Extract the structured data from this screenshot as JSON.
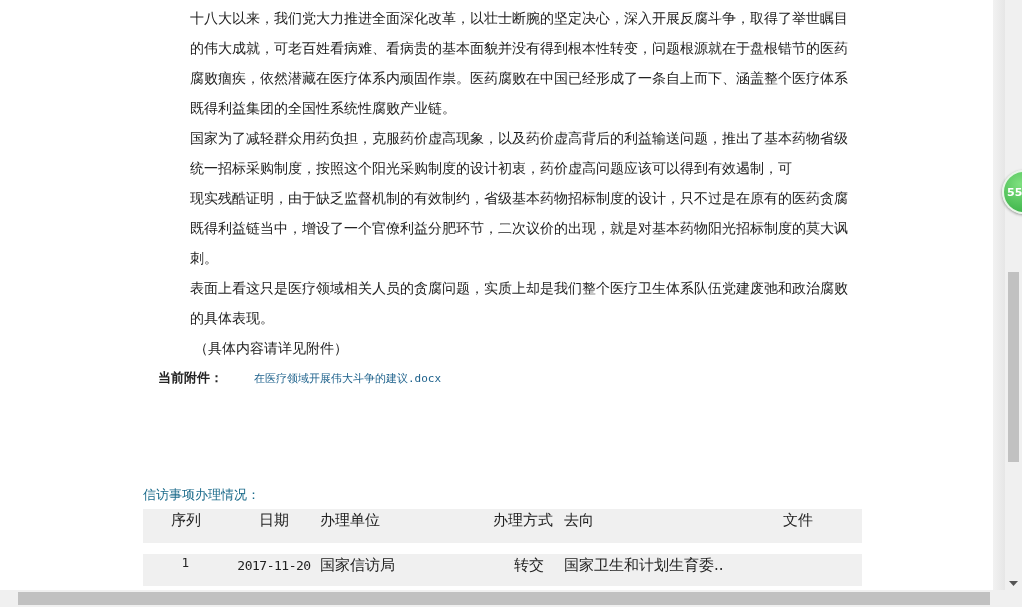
{
  "article": {
    "paragraphs": [
      "十八大以来，我们党大力推进全面深化改革，以壮士断腕的坚定决心，深入开展反腐斗争，取得了举世瞩目的伟大成就，可老百姓看病难、看病贵的基本面貌并没有得到根本性转变，问题根源就在于盘根错节的医药腐败痼疾，依然潜藏在医疗体系内顽固作祟。医药腐败在中国已经形成了一条自上而下、涵盖整个医疗体系既得利益集团的全国性系统性腐败产业链。",
      "国家为了减轻群众用药负担，克服药价虚高现象，以及药价虚高背后的利益输送问题，推出了基本药物省级统一招标采购制度，按照这个阳光采购制度的设计初衷，药价虚高问题应该可以得到有效遏制，可",
      "现实残酷证明，由于缺乏监督机制的有效制约，省级基本药物招标制度的设计，只不过是在原有的医药贪腐既得利益链当中，增设了一个官僚利益分肥环节，二次议价的出现，就是对基本药物阳光招标制度的莫大讽刺。",
      "表面上看这只是医疗领域相关人员的贪腐问题，实质上却是我们整个医疗卫生体系队伍党建废弛和政治腐败的具体表现。"
    ],
    "note": "（具体内容请详见附件）"
  },
  "attachment": {
    "label": "当前附件：",
    "file": "在医疗领域开展伟大斗争的建议.docx"
  },
  "handling": {
    "title": "信访事项办理情况：",
    "columns": [
      "序列",
      "日期",
      "办理单位",
      "办理方式",
      "去向",
      "文件"
    ],
    "rows": [
      {
        "cells": [
          "1",
          "2017-11-20",
          "国家信访局",
          "转交",
          "国家卫生和计划生育委..",
          ""
        ]
      }
    ]
  },
  "badge": "55"
}
